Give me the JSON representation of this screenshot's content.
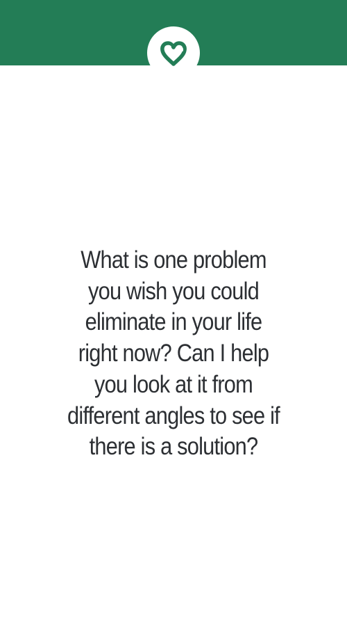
{
  "colors": {
    "header": "#237d56",
    "accent": "#237d56",
    "background": "#ffffff",
    "text": "#2c2f33"
  },
  "icon": {
    "name": "heart-icon"
  },
  "prompt": {
    "text": "What is one problem\nyou wish you could\neliminate in your life\nright now? Can I help\nyou look at it from\ndifferent angles to see if\nthere is a solution?"
  }
}
